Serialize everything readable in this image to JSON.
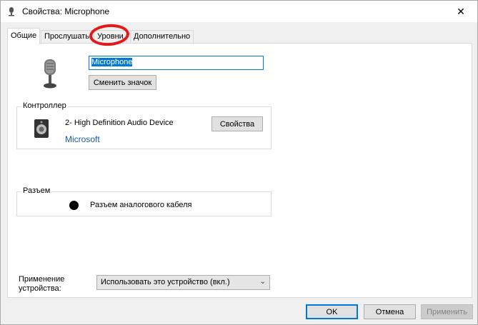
{
  "window": {
    "title": "Свойства: Microphone",
    "close_glyph": "✕"
  },
  "tabs": [
    {
      "label": "Общие",
      "active": true
    },
    {
      "label": "Прослушать",
      "active": false
    },
    {
      "label": "Уровни",
      "active": false
    },
    {
      "label": "Дополнительно",
      "active": false
    }
  ],
  "device": {
    "name_value": "Microphone",
    "change_icon_label": "Сменить значок"
  },
  "controller": {
    "group_label": "Контроллер",
    "device_name": "2- High Definition Audio Device",
    "vendor": "Microsoft",
    "properties_label": "Свойства"
  },
  "jack": {
    "group_label": "Разъем",
    "description": "Разъем аналогового кабеля"
  },
  "usage": {
    "label": "Применение устройства:",
    "selected": "Использовать это устройство (вкл.)"
  },
  "footer": {
    "ok_label": "OK",
    "cancel_label": "Отмена",
    "apply_label": "Применить"
  },
  "colors": {
    "accent": "#0078d7",
    "annotation": "#e21a1a",
    "link": "#1a5aa6"
  },
  "icons": {
    "title": "microphone-icon",
    "device": "microphone-icon",
    "controller": "speaker-icon",
    "close": "close-icon",
    "dropdown": "chevron-down-icon"
  }
}
